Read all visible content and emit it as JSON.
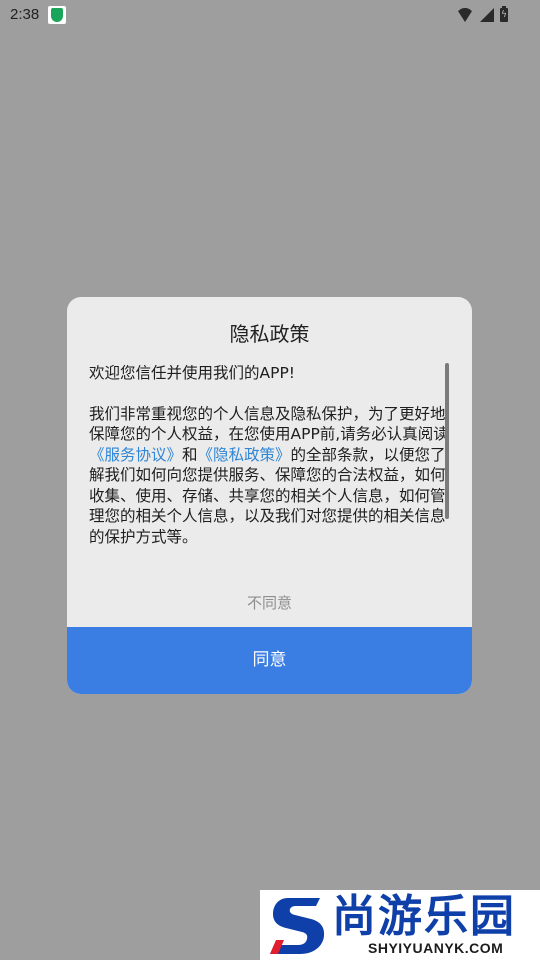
{
  "status_bar": {
    "time": "2:38",
    "icons": [
      "app-shield-icon",
      "wifi-icon",
      "signal-icon",
      "battery-icon"
    ]
  },
  "dialog": {
    "title": "隐私政策",
    "intro": "欢迎您信任并使用我们的APP!",
    "body_part1": " 我们非常重视您的个人信息及隐私保护，为了更好地保障您的个人权益，在您使用APP前,请务必认真阅读",
    "link_service": "《服务协议》",
    "and_text": "和",
    "link_privacy": "《隐私政策》",
    "body_part2": "的全部条款，以便您了解我们如何向您提供服务、保障您的合法权益，如何收集、使用、存储、共享您的相关个人信息，如何管理您的相关个人信息，以及我们对您提供的相关信息的保护方式等。",
    "decline_label": "不同意",
    "agree_label": "同意"
  },
  "watermark": {
    "name": "尚游乐园",
    "url": "SHYIYUANYK.COM"
  },
  "colors": {
    "overlay_background": "#9e9e9e",
    "dialog_background": "#ebebeb",
    "primary_button": "#3a7ee3",
    "link": "#2f86d6",
    "watermark_blue": "#0f3fa8"
  }
}
